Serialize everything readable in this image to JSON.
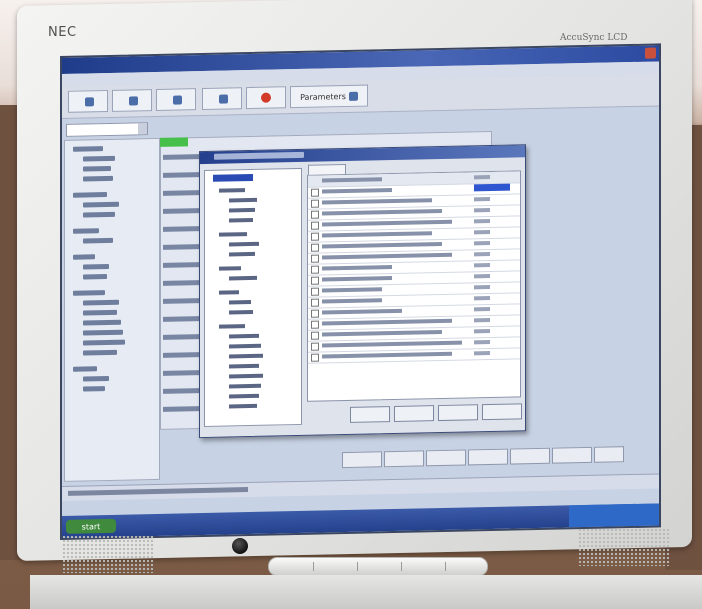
{
  "monitor": {
    "brand": "NEC",
    "model": "AccuSync LCD"
  },
  "app": {
    "toolbar_buttons": [
      "",
      "",
      "",
      "",
      "",
      "Parameters"
    ],
    "dialog_buttons": [
      "",
      "",
      "",
      ""
    ],
    "nav_buttons": [
      "",
      "",
      "",
      "",
      "",
      "",
      "",
      ""
    ],
    "start_label": "start"
  }
}
